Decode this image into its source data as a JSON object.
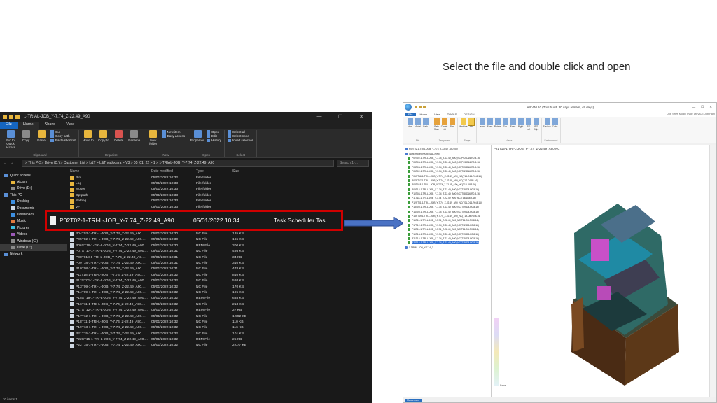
{
  "caption": "Select the file and double click and open",
  "explorer": {
    "title": "1-TRIAL-JOB_Y-7.74_Z-22.49_A90",
    "tabs": [
      "File",
      "Home",
      "Share",
      "View"
    ],
    "ribbon": {
      "clipboard": {
        "label": "Clipboard",
        "pin": "Pin to Quick access",
        "copy": "Copy",
        "paste": "Paste",
        "cut": "Cut",
        "copy_path": "Copy path",
        "paste_shortcut": "Paste shortcut"
      },
      "organise": {
        "label": "Organise",
        "move": "Move to",
        "copy": "Copy to",
        "delete": "Delete",
        "rename": "Rename"
      },
      "new": {
        "label": "New",
        "folder": "New folder",
        "item": "New item",
        "easy": "Easy access"
      },
      "open": {
        "label": "Open",
        "properties": "Properties",
        "open": "Open",
        "edit": "Edit",
        "history": "History"
      },
      "select": {
        "label": "Select",
        "all": "Select all",
        "none": "Select none",
        "invert": "Invert selection"
      }
    },
    "path": "> This PC > Drive (D:) > Customer List > L&T > L&T vadodara > V3 > 05_01_22 > 1 > 1-TRIAL-JOB_Y-7.74_Z-22.49_A90",
    "search_placeholder": "Search 1-...",
    "nav": [
      {
        "label": "Quick access",
        "lv": 1,
        "color": "#5a8fd6"
      },
      {
        "label": "Aicam",
        "lv": 2,
        "color": "#e8b63d"
      },
      {
        "label": "Drive (D:)",
        "lv": 2,
        "color": "#8a8a8a"
      },
      {
        "label": "This PC",
        "lv": 1,
        "color": "#5a8fd6"
      },
      {
        "label": "Desktop",
        "lv": 2,
        "color": "#3d8fe0"
      },
      {
        "label": "Documents",
        "lv": 2,
        "color": "#cfd8e3"
      },
      {
        "label": "Downloads",
        "lv": 2,
        "color": "#3d8fe0"
      },
      {
        "label": "Music",
        "lv": 2,
        "color": "#e07a3d"
      },
      {
        "label": "Pictures",
        "lv": 2,
        "color": "#3dbfe0"
      },
      {
        "label": "Videos",
        "lv": 2,
        "color": "#9b59b6"
      },
      {
        "label": "Windows (C:)",
        "lv": 2,
        "color": "#8a8a8a"
      },
      {
        "label": "Drive (D:)",
        "lv": 2,
        "color": "#8a8a8a",
        "sel": true
      },
      {
        "label": "Network",
        "lv": 1,
        "color": "#5a8fd6"
      }
    ],
    "columns": [
      "Name",
      "Date modified",
      "Type",
      "Size"
    ],
    "rows_top": [
      {
        "name": "Bin",
        "date": "05/01/2022 10:32",
        "type": "File folder",
        "size": "",
        "kind": "folder"
      },
      {
        "name": "Log",
        "date": "05/01/2022 10:33",
        "type": "File folder",
        "size": "",
        "kind": "folder"
      },
      {
        "name": "Model",
        "date": "05/01/2022 10:33",
        "type": "File folder",
        "size": "",
        "kind": "folder"
      },
      {
        "name": "Optpath",
        "date": "05/01/2022 10:33",
        "type": "File folder",
        "size": "",
        "kind": "folder"
      },
      {
        "name": "Setting",
        "date": "05/01/2022 10:33",
        "type": "File folder",
        "size": "",
        "kind": "folder"
      },
      {
        "name": "VF",
        "date": "05/01/2022 10:33",
        "type": "File folder",
        "size": "",
        "kind": "folder"
      }
    ],
    "highlight": {
      "name": "P02T02-1-TRI-L-JOB_Y-7.74_Z-22.49_A90....",
      "date": "05/01/2022 10:34",
      "type": "Task Scheduler Tas..."
    },
    "rows_bottom": [
      {
        "name": "P04T03-1-TRI-L-JOB_Y-7.74_Z-22.49_A90....",
        "date": "05/01/2022 10:30",
        "type": "NC File",
        "size": "135 KB"
      },
      {
        "name": "P05T02-1-TRI-L-JOB_Y-7.74_Z-22.49_A90....",
        "date": "05/01/2022 10:30",
        "type": "NC File",
        "size": "165 KB"
      },
      {
        "name": "P06ST16-1-TRI-L-JOB_Y-7.74_Z-22.49_A90....",
        "date": "05/01/2022 10:30",
        "type": "REM File",
        "size": "300 KB"
      },
      {
        "name": "P07ST17-1-TRI-L-JOB_Y-7.74_Z-22.49_A90....",
        "date": "05/01/2022 10:31",
        "type": "NC File",
        "size": "498 KB"
      },
      {
        "name": "P08T018-1-TRI-L-JOB_Y-7.74_Z-22.49_A9....",
        "date": "05/01/2022 10:31",
        "type": "NC File",
        "size": "34 KB"
      },
      {
        "name": "P09T18-1-TRI-L-JOB_Y-7.74_Z-22.49_A90....",
        "date": "05/01/2022 10:31",
        "type": "NC File",
        "size": "310 KB"
      },
      {
        "name": "P10T08-1-TRI-L-JOB_Y-7.74_Z-22.49_A90....",
        "date": "05/01/2022 10:31",
        "type": "NC File",
        "size": "478 KB"
      },
      {
        "name": "P11T18-1-TRI-L-JOB_Y-7.74_Z-22.49_A90....",
        "date": "05/01/2022 10:32",
        "type": "NC File",
        "size": "810 KB"
      },
      {
        "name": "P12ST01-1-TRI-L-JOB_Y-7.74_Z-22.49_A90....",
        "date": "05/01/2022 10:32",
        "type": "NC File",
        "size": "598 KB"
      },
      {
        "name": "P13T09-1-TRI-L-JOB_Y-7.74_Z-22.49_A90....",
        "date": "05/01/2022 10:32",
        "type": "NC File",
        "size": "170 KB"
      },
      {
        "name": "P14T09-1-TRI-L-JOB_Y-7.74_Z-22.49_A90....",
        "date": "05/01/2022 10:32",
        "type": "NC File",
        "size": "195 KB"
      },
      {
        "name": "P15ST19-1-TRI-L-JOB_Y-7.74_Z-22.49_A90....",
        "date": "05/01/2022 10:32",
        "type": "REM File",
        "size": "638 KB"
      },
      {
        "name": "P16T11-1-TRI-L-JOB_Y-7.74_Z-22.49_A90....",
        "date": "05/01/2022 10:32",
        "type": "NC File",
        "size": "213 KB"
      },
      {
        "name": "P17ST12-1-TRI-L-JOB_Y-7.74_Z-22.49_A90....",
        "date": "05/01/2022 10:32",
        "type": "REM File",
        "size": "27 KB"
      },
      {
        "name": "P17T12-1-TRI-L-JOB_Y-7.74_Z-22.49_A90....",
        "date": "05/01/2022 10:32",
        "type": "NC File",
        "size": "1,592 KB"
      },
      {
        "name": "P18T11-1-TRI-L-JOB_Y-7.74_Z-22.49_A90....",
        "date": "05/01/2022 10:32",
        "type": "NC File",
        "size": "110 KB"
      },
      {
        "name": "P19T13-1-TRI-L-JOB_Y-7.74_Z-22.49_A90....",
        "date": "05/01/2022 10:32",
        "type": "NC File",
        "size": "116 KB"
      },
      {
        "name": "P21T15-1-TRI-L-JOB_Y-7.74_Z-22.49_A90....",
        "date": "05/01/2022 10:32",
        "type": "NC File",
        "size": "101 KB"
      },
      {
        "name": "P22ST15-1-TRI-L-JOB_Y-7.74_Z-22.49_A90....",
        "date": "05/01/2022 10:32",
        "type": "REM File",
        "size": "25 KB"
      },
      {
        "name": "P22T15-1-TRI-L-JOB_Y-7.74_Z-22.49_A90....",
        "date": "05/01/2022 10:32",
        "type": "NC File",
        "size": "2,077 KB"
      }
    ],
    "status": "30 items   1"
  },
  "cam": {
    "title": "AICAM 10 (Trial build, 30 days remain, 49 days)",
    "menu": [
      "File",
      "Home",
      "View",
      "TOOLS",
      "DESIGN"
    ],
    "menu_right": "Job  Save  Model  Plate  DEVICE  Job  Path",
    "ribbon_groups": [
      {
        "label": "File",
        "buttons": [
          "New",
          "Model",
          "Path"
        ],
        "color": "#7fa7d9"
      },
      {
        "label": "Templates",
        "buttons": [
          "Path Save",
          "Create List",
          "Run"
        ],
        "color": "#e6a23c"
      },
      {
        "label": "Stage",
        "buttons": [
          "Machine",
          "Job"
        ],
        "color": "#f2c94c",
        "selected": 1
      },
      {
        "label": "Views",
        "buttons": [
          "Isom",
          "Front",
          "Rotate",
          "Top",
          "Front",
          "Right",
          "ISO Left",
          "ISO Right"
        ],
        "color": "#7fa7d9"
      },
      {
        "label": "Environment",
        "buttons": [
          "Environ.",
          "Color"
        ],
        "color": "#7fa7d9"
      }
    ],
    "tree": [
      {
        "label": "P02T02-1-TRI-L-JOB_Y-7.74_Z-22.49_A90_job",
        "root": true
      },
      {
        "label": "Work model: KARE MACHINE",
        "root": true
      },
      {
        "label": "P02T02-1-TRI-L-JOB_Y-7.74_Z-22.49_A90_NC(P02-D16-R0.8-16)",
        "sub": true
      },
      {
        "label": "P03T03-1-TRI-L-JOB_Y-7.74_Z-22.49_A90_NC(P03-D16-R0.8-16)",
        "sub": true
      },
      {
        "label": "P04T03-1-TRI-L-JOB_Y-7.74_Z-22.49_A90_NC(T03-D16-R0.8-16)",
        "sub": true
      },
      {
        "label": "P05T02-1-TRI-L-JOB_Y-7.74_Z-22.49_A90_NC(T02-D16-R0.8-16)",
        "sub": true
      },
      {
        "label": "P06ST16-1-TRI-L-JOB_Y-7.74_Z-22.49_A90_NC(T16-D16-R0.8-16)",
        "sub": true
      },
      {
        "label": "P07ST17-1-TRI-L-JOB_Y-7.74_Z-22.49_A90_NC(T17-D16R-16)",
        "sub": true
      },
      {
        "label": "P08T018-1-TRI-L-JOB_Y-7.74_Z-22.49_A90_NC(T18-D8R-16)",
        "sub": true
      },
      {
        "label": "P09T18-1-TRI-L-JOB_Y-7.74_Z-22.49_A90_NC(T18-D8-R0.5-16)",
        "sub": true
      },
      {
        "label": "P10T08-1-TRI-L-JOB_Y-7.74_Z-22.49_A90_NC(T08-D16-R0.8-16)",
        "sub": true
      },
      {
        "label": "P11T18-1-TRI-L-JOB_Y-7.74_Z-22.49_A90_NC(T18-D16R-16)",
        "sub": true
      },
      {
        "label": "P12ST01-1-TRI-L-JOB_Y-7.74_Z-22.49_A90_NC(T01-D16-R0.8-16)",
        "sub": true
      },
      {
        "label": "P13T09-1-TRI-L-JOB_Y-7.74_Z-22.49_A90_NC(T09-D8-R0.8-16)",
        "sub": true
      },
      {
        "label": "P14T09-1-TRI-L-JOB_Y-7.74_Z-22.49_A90_NC(T09-D8-R0.8-16)",
        "sub": true
      },
      {
        "label": "P15ST19-1-TRI-L-JOB_Y-7.74_Z-22.49_A90_NC(T19-D8-R0.8-16)",
        "sub": true
      },
      {
        "label": "P16T11-1-TRI-L-JOB_Y-7.74_Z-22.49_A90_NC(T11-D8-R0.8-16)",
        "sub": true
      },
      {
        "label": "P17T12-1-TRI-L-JOB_Y-7.74_Z-22.49_A90_NC(T12-D8-R0.8-16)",
        "sub": true
      },
      {
        "label": "P18T11-1-TRI-L-JOB_Y-7.74_Z-22.49_A90_NC(T11-D8-R0.8-16)",
        "sub": true
      },
      {
        "label": "P19T13-1-TRI-L-JOB_Y-7.74_Z-22.49_A90_NC(T13-D8-R0.8-16)",
        "sub": true
      },
      {
        "label": "P21T15-1-TRI-L-JOB_Y-7.74_Z-22.49_A90_NC(T15-D8-R0.5-16)",
        "sub": true
      },
      {
        "label": "P22T15-1-TRI-L-JOB_Y-7.74_Z-22.49_A90_NC(T15-D8-R0.5-16)",
        "sub": true,
        "sel": true
      },
      {
        "label": "1-TRIAL-JOB_Y-7.74_Z...",
        "root": true
      }
    ],
    "view_title": "P21T15-1-TRI-L-JOB_Y-7.74_Z-22.49_A90.NC",
    "view_label": "Name",
    "status": "Mastercam"
  }
}
